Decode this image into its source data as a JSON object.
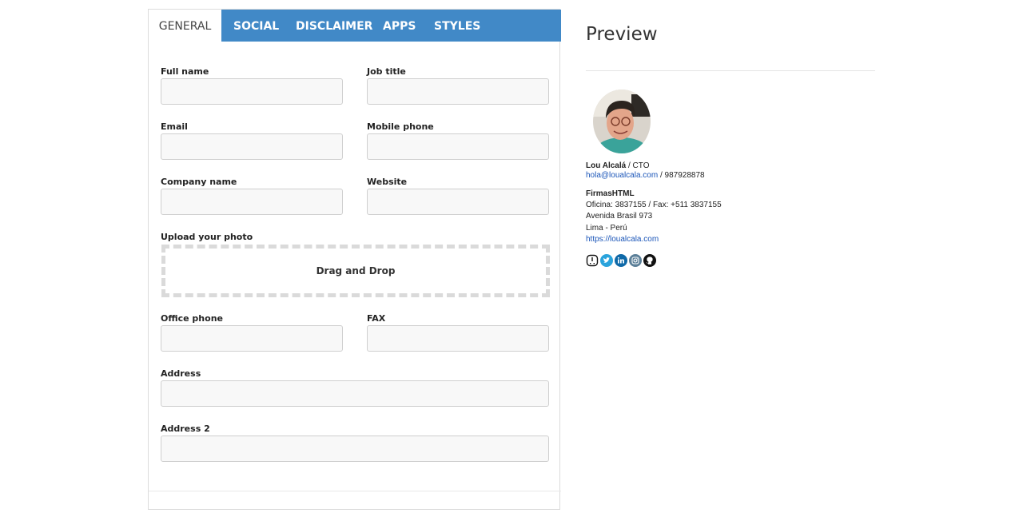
{
  "tabs": [
    "GENERAL",
    "SOCIAL",
    "DISCLAIMER",
    "APPS",
    "STYLES"
  ],
  "form": {
    "full_name_label": "Full name",
    "job_title_label": "Job title",
    "email_label": "Email",
    "mobile_label": "Mobile phone",
    "company_label": "Company name",
    "website_label": "Website",
    "upload_label": "Upload your photo",
    "drop_text": "Drag and Drop",
    "office_phone_label": "Office phone",
    "fax_label": "FAX",
    "address_label": "Address",
    "address2_label": "Address 2"
  },
  "preview": {
    "title": "Preview",
    "name": "Lou Alcalá",
    "title_sep": " / CTO",
    "email": "hola@loualcala.com",
    "mobile": " / 987928878",
    "company": "FirmasHTML",
    "phones": "Oficina: 3837155 / Fax: +511 3837155",
    "address": "Avenida Brasil 973",
    "city": "Lima - Perú",
    "website": "https://loualcala.com"
  },
  "social_icons": [
    "stopwatch-icon",
    "twitter-icon",
    "linkedin-icon",
    "instagram-icon",
    "github-icon"
  ],
  "colors": {
    "tab_bar": "#4189c7",
    "link": "#1a55b8"
  }
}
